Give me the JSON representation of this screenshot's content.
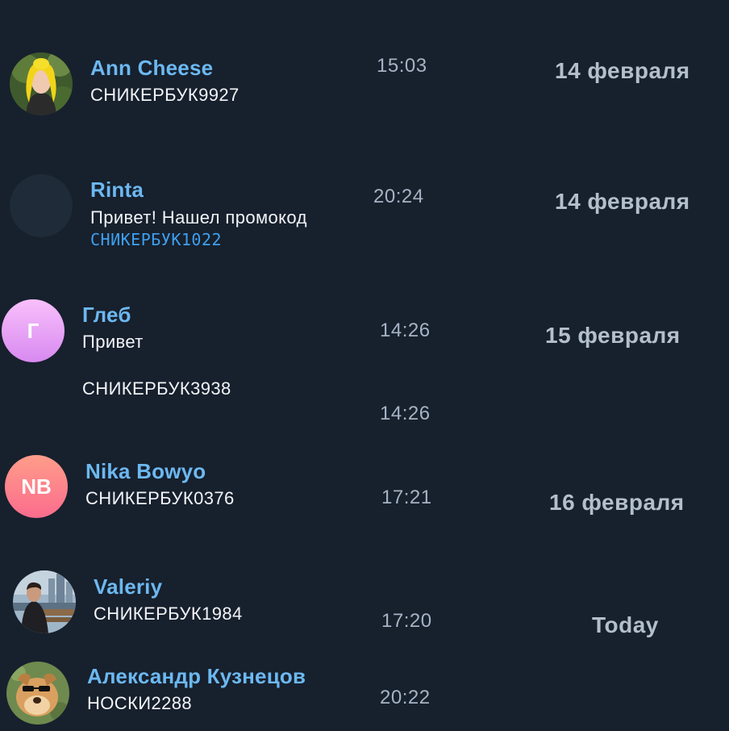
{
  "colors": {
    "background": "#17202d",
    "name": "#6cb8f1",
    "message": "#f2f4f7",
    "link": "#3ea0ee",
    "time": "#a6b3c4",
    "date": "#b4bfcc"
  },
  "chats": [
    {
      "name": "Ann Cheese",
      "messages": [
        "СНИКЕРБУК9927"
      ],
      "times": [
        "15:03"
      ],
      "date": "14 февраля",
      "avatar": {
        "type": "photo",
        "icon": "person-photo-yellow-hair"
      }
    },
    {
      "name": "Rinta",
      "messages": [
        "Привет! Нашел промокод",
        "СНИКЕРБУК1022"
      ],
      "times": [
        "20:24"
      ],
      "date": "14 февраля",
      "avatar": {
        "type": "empty",
        "color": "#1f2b38"
      }
    },
    {
      "name": "Глеб",
      "messages": [
        "Привет",
        "СНИКЕРБУК3938"
      ],
      "times": [
        "14:26",
        "14:26"
      ],
      "date": "15 февраля",
      "avatar": {
        "type": "initials",
        "initials": "Г",
        "gradient": [
          "#f8c0fb",
          "#d889f0"
        ]
      }
    },
    {
      "name": "Nika Bowyo",
      "messages": [
        "СНИКЕРБУК0376"
      ],
      "times": [
        "17:21"
      ],
      "date": "16 февраля",
      "avatar": {
        "type": "initials",
        "initials": "NB",
        "gradient": [
          "#ff9d8a",
          "#fb6c8d"
        ]
      }
    },
    {
      "name": "Valeriy",
      "messages": [
        "СНИКЕРБУК1984"
      ],
      "times": [
        "17:20"
      ],
      "date": "Today",
      "avatar": {
        "type": "photo",
        "icon": "person-photo-city"
      }
    },
    {
      "name": "Александр Кузнецов",
      "messages": [
        "НОСКИ2288"
      ],
      "times": [
        "20:22"
      ],
      "date": "",
      "avatar": {
        "type": "photo",
        "icon": "cartoon-dog-avatar"
      }
    }
  ]
}
